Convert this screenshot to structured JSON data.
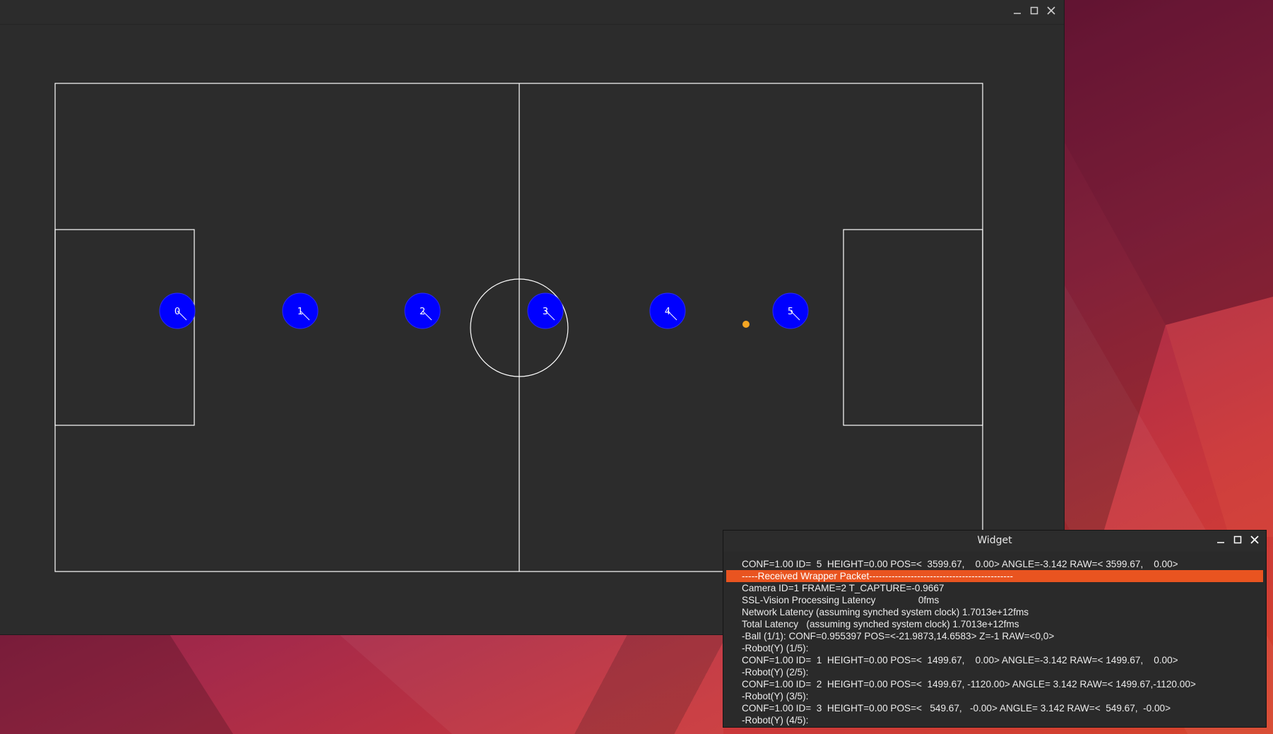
{
  "main_window": {
    "controls": [
      "minimize",
      "maximize",
      "close"
    ]
  },
  "field": {
    "line_color": "#ffffff",
    "background": "#2c2c2c",
    "robot_color": "#0000ff",
    "ball_color": "#f5a623",
    "robots": [
      {
        "id": "0"
      },
      {
        "id": "1"
      },
      {
        "id": "2"
      },
      {
        "id": "3"
      },
      {
        "id": "4"
      },
      {
        "id": "5"
      }
    ]
  },
  "widget": {
    "title": "Widget",
    "highlight_color": "#e95420",
    "log_lines": [
      {
        "text": "CONF=1.00 ID=  5  HEIGHT=0.00 POS=<  3599.67,    0.00> ANGLE=-3.142 RAW=< 3599.67,    0.00>"
      },
      {
        "text": "-----Received Wrapper Packet---------------------------------------------",
        "highlight": true
      },
      {
        "text": "Camera ID=1 FRAME=2 T_CAPTURE=-0.9667"
      },
      {
        "text": "SSL-Vision Processing Latency                0fms"
      },
      {
        "text": "Network Latency (assuming synched system clock) 1.7013e+12fms"
      },
      {
        "text": "Total Latency   (assuming synched system clock) 1.7013e+12fms"
      },
      {
        "text": "-Ball (1/1): CONF=0.955397 POS=<-21.9873,14.6583> Z=-1 RAW=<0,0>"
      },
      {
        "text": "-Robot(Y) (1/5):"
      },
      {
        "text": "CONF=1.00 ID=  1  HEIGHT=0.00 POS=<  1499.67,    0.00> ANGLE=-3.142 RAW=< 1499.67,    0.00>"
      },
      {
        "text": "-Robot(Y) (2/5):"
      },
      {
        "text": "CONF=1.00 ID=  2  HEIGHT=0.00 POS=<  1499.67, -1120.00> ANGLE= 3.142 RAW=< 1499.67,-1120.00>"
      },
      {
        "text": "-Robot(Y) (3/5):"
      },
      {
        "text": "CONF=1.00 ID=  3  HEIGHT=0.00 POS=<   549.67,   -0.00> ANGLE= 3.142 RAW=<  549.67,  -0.00>"
      },
      {
        "text": "-Robot(Y) (4/5):"
      }
    ]
  }
}
